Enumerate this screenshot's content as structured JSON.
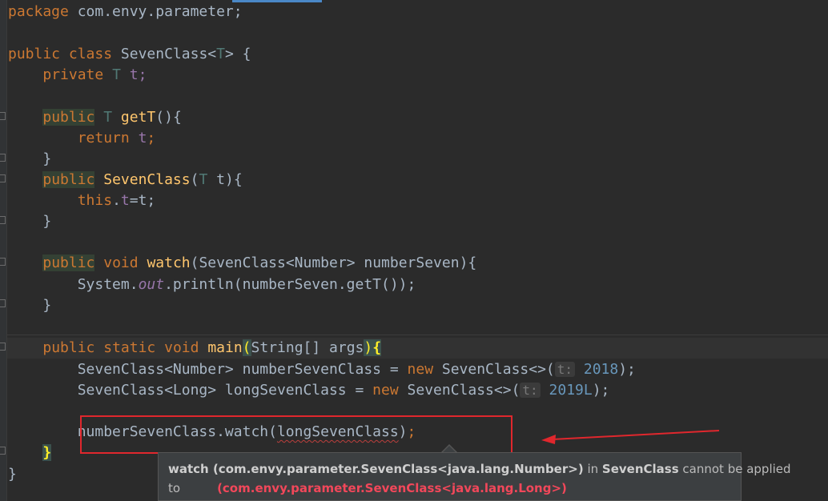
{
  "editor": {
    "lines": [
      [
        "package",
        " com.envy.parameter;"
      ],
      [
        "public",
        "class",
        "SevenClass",
        "T",
        "{"
      ],
      [
        "private",
        "T",
        "t;"
      ],
      [
        "public",
        "T",
        "getT",
        "(){"
      ],
      [
        "return",
        "t",
        ";"
      ],
      [
        "}"
      ],
      [
        "public",
        "SevenClass",
        "(",
        "T",
        "t){"
      ],
      [
        "this",
        ".",
        "t",
        "=t;"
      ],
      [
        "}"
      ],
      [
        "public",
        "void",
        "watch",
        "(SevenClass<Number> numberSeven){"
      ],
      [
        "System.",
        "out",
        ".println(numberSeven.getT());"
      ],
      [
        "}"
      ],
      [
        "public",
        "static",
        "void",
        "main",
        "(",
        "String[] args",
        ")",
        "{"
      ],
      [
        "SevenClass<Number> numberSevenClass = ",
        "new",
        " SevenClass<>(",
        "t:",
        "2018",
        ");"
      ],
      [
        "SevenClass<Long> longSevenClass = ",
        "new",
        " SevenClass<>(",
        "t:",
        "2019L",
        ");"
      ],
      [
        "numberSevenClass.watch(",
        "longSevenClass",
        ")",
        ";"
      ],
      [
        "}"
      ],
      [
        "}"
      ]
    ]
  },
  "tooltip": {
    "part1": "watch (com.envy.parameter.SevenClass<java.lang.Number>)",
    "part2": " in ",
    "part3": "SevenClass",
    "part4": " cannot be applied",
    "part5": "to",
    "part6": "(com.envy.parameter.SevenClass<java.lang.Long>)"
  },
  "colors": {
    "background": "#2b2b2b",
    "keyword": "#cc7832",
    "method": "#ffc66d",
    "error_box": "#e0272d",
    "tooltip_error": "#f2475a"
  }
}
